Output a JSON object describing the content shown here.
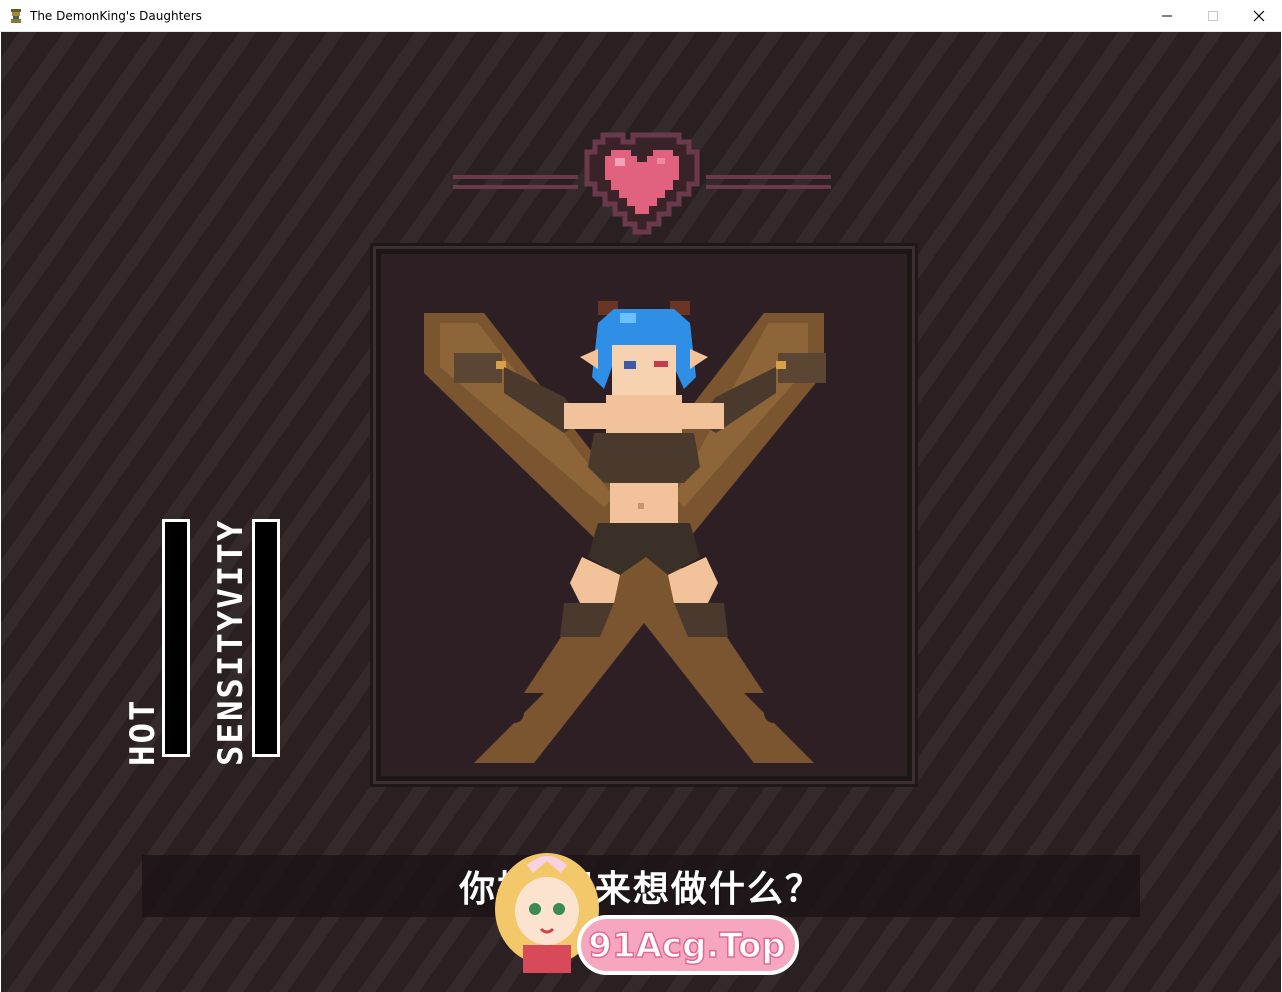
{
  "window": {
    "title": "The DemonKing's Daughters",
    "controls": [
      "minimize",
      "maximize",
      "close"
    ]
  },
  "hud": {
    "hot": {
      "label": "HOT",
      "level": 0.0
    },
    "sensitivity": {
      "label": "SENSITYVITY",
      "level": 0.0
    }
  },
  "dialogue": {
    "text": "你把▯起来想做什么？"
  },
  "watermark": {
    "text": "91Acg.Top"
  },
  "colors": {
    "background": "#2a2022",
    "heart": "#e0627e",
    "heart_frame": "#6a3a4c",
    "gauge_border": "#ffffff",
    "hair": "#2f8fe6",
    "cross": "#7b5530"
  }
}
